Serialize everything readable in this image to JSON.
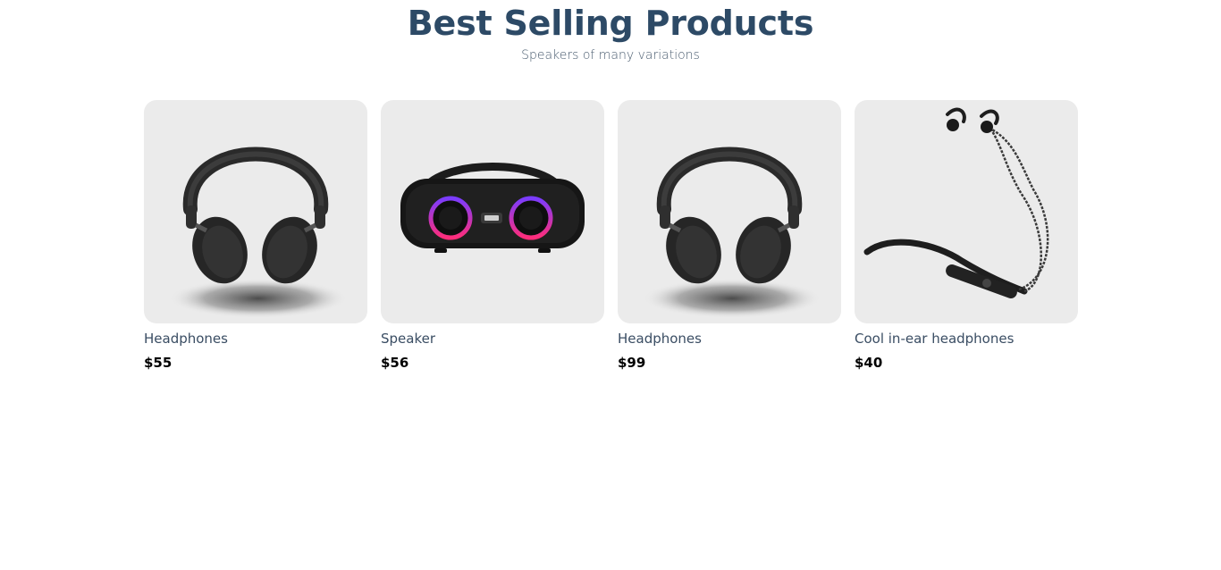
{
  "header": {
    "title": "Best Selling Products",
    "subtitle": "Speakers of many variations"
  },
  "products": [
    {
      "name": "Headphones",
      "price": "$55",
      "icon": "headphones-icon"
    },
    {
      "name": "Speaker",
      "price": "$56",
      "icon": "speaker-icon"
    },
    {
      "name": "Headphones",
      "price": "$99",
      "icon": "headphones-icon"
    },
    {
      "name": "Cool in-ear headphones",
      "price": "$40",
      "icon": "earphones-icon"
    }
  ],
  "colors": {
    "title": "#2d4a66",
    "card_background": "#ebebeb",
    "speaker_ring_start": "#7b3cff",
    "speaker_ring_end": "#ff2d7a"
  }
}
